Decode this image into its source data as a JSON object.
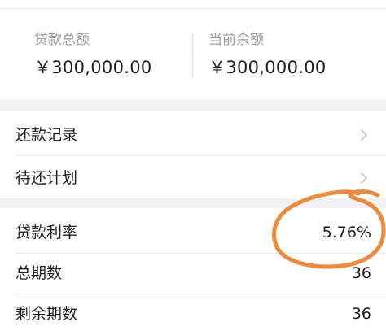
{
  "summary": {
    "total_loan_label": "贷款总额",
    "total_loan_value": "￥300,000.00",
    "current_balance_label": "当前余额",
    "current_balance_value": "￥300,000.00"
  },
  "menu": {
    "repayment_record_label": "还款记录",
    "pending_plan_label": "待还计划"
  },
  "details": {
    "interest_rate_label": "贷款利率",
    "interest_rate_value": "5.76%",
    "total_periods_label": "总期数",
    "total_periods_value": "36",
    "remaining_periods_label": "剩余期数",
    "remaining_periods_value": "36"
  },
  "icons": {
    "row_arrow": "chevron-right-icon"
  },
  "colors": {
    "highlight_stroke": "#ee8a3a",
    "page_background": "#f2f2f4",
    "label_gray": "#9a9aa0",
    "text_dark": "#1f1f1f"
  }
}
